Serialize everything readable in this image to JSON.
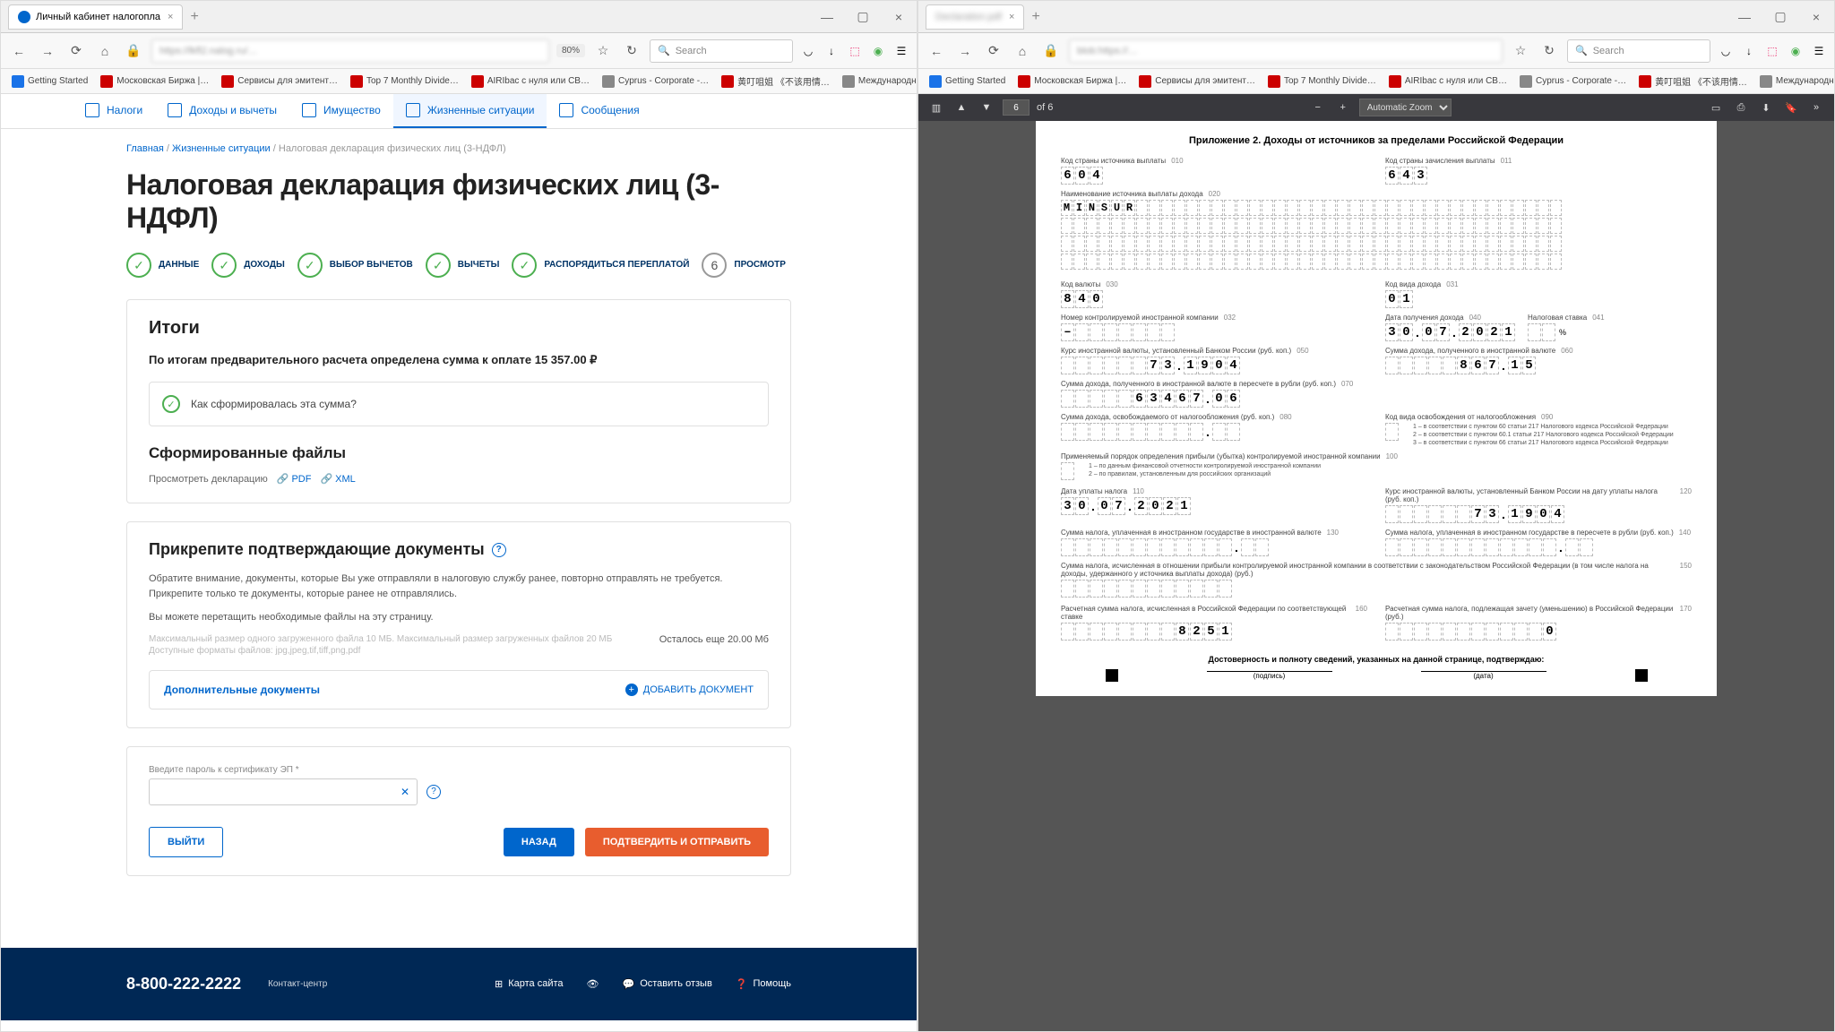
{
  "left": {
    "tab_title": "Личный кабинет налогопла",
    "zoom": "80%",
    "search_placeholder": "Search",
    "bookmarks": [
      "Getting Started",
      "Московская Биржа |…",
      "Сервисы для эмитент…",
      "Top 7 Monthly Divide…",
      "AIRIbac с нуля или СВ…",
      "Cyprus - Corporate -…",
      "黄叮咀姐 《不该用情…",
      "Международные ры…"
    ],
    "nav_items": [
      "Налоги",
      "Доходы и вычеты",
      "Имущество",
      "Жизненные ситуации",
      "Сообщения"
    ],
    "breadcrumb_home": "Главная",
    "breadcrumb_section": "Жизненные ситуации",
    "breadcrumb_current": "Налоговая декларация физических лиц (3-НДФЛ)",
    "page_title": "Налоговая декларация физических лиц (3-НДФЛ)",
    "steps": [
      "ДАННЫЕ",
      "ДОХОДЫ",
      "ВЫБОР ВЫЧЕТОВ",
      "ВЫЧЕТЫ",
      "РАСПОРЯДИТЬСЯ ПЕРЕПЛАТОЙ",
      "ПРОСМОТР"
    ],
    "results_heading": "Итоги",
    "results_text": "По итогам предварительного расчета определена сумма к оплате 15 357.00 ₽",
    "how_formed": "Как сформировалась эта сумма?",
    "files_heading": "Сформированные файлы",
    "view_declaration": "Просмотреть декларацию",
    "pdf_label": "PDF",
    "xml_label": "XML",
    "attach_heading": "Прикрепите подтверждающие документы",
    "attach_note1": "Обратите внимание, документы, которые Вы уже отправляли в налоговую службу ранее, повторно отправлять не требуется. Прикрепите только те документы, которые ранее не отправлялись.",
    "attach_note2": "Вы можете перетащить необходимые файлы на эту страницу.",
    "size_hint": "Максимальный размер одного загруженного файла 10 МБ. Максимальный размер загруженных файлов 20 МБ",
    "format_hint": "Доступные форматы файлов: jpg,jpeg,tif,tiff,png,pdf",
    "remaining": "Осталось еще 20.00 Мб",
    "extra_docs": "Дополнительные документы",
    "add_doc": "ДОБАВИТЬ ДОКУМЕНТ",
    "pwd_label": "Введите пароль к сертификату ЭП *",
    "btn_exit": "ВЫЙТИ",
    "btn_back": "НАЗАД",
    "btn_submit": "ПОДТВЕРДИТЬ И ОТПРАВИТЬ",
    "phone": "8-800-222-2222",
    "contact_center": "Контакт-центр",
    "footer_links": [
      "Карта сайта",
      "",
      "Оставить отзыв",
      "Помощь"
    ]
  },
  "right": {
    "page_current": "6",
    "page_total": "of 6",
    "zoom_mode": "Automatic Zoom",
    "doc_title": "Приложение 2. Доходы от источников за пределами Российской Федерации",
    "f010_label": "Код страны источника выплаты",
    "f010_code": "010",
    "f010_val": "604",
    "f011_label": "Код страны зачисления выплаты",
    "f011_code": "011",
    "f011_val": "643",
    "f020_label": "Наименование источника выплаты дохода",
    "f020_code": "020",
    "f020_val": "MINSUR",
    "f030_label": "Код валюты",
    "f030_code": "030",
    "f030_val": "840",
    "f031_label": "Код вида дохода",
    "f031_code": "031",
    "f031_val": "01",
    "f032_label": "Номер контролируемой иностранной компании",
    "f032_code": "032",
    "f032_val": "–",
    "f040_label": "Дата получения дохода",
    "f040_code": "040",
    "f040_val": "30.07.2021",
    "f041_label": "Налоговая ставка",
    "f041_code": "041",
    "f041_unit": "%",
    "f050_label": "Курс иностранной валюты, установленный Банком России (руб. коп.)",
    "f050_code": "050",
    "f050_val": "73.1904",
    "f060_label": "Сумма дохода, полученного в иностранной валюте",
    "f060_code": "060",
    "f060_val": "867.15",
    "f070_label": "Сумма дохода, полученного в иностранной валюте в пересчете в рубли (руб. коп.)",
    "f070_code": "070",
    "f070_val": "63467.06",
    "f080_label": "Сумма дохода, освобождаемого от налогообложения (руб. коп.)",
    "f080_code": "080",
    "f090_label": "Код вида освобождения от налогообложения",
    "f090_code": "090",
    "f090_legend1": "1 – в соответствии с пунктом 60 статьи 217 Налогового кодекса Российской Федерации",
    "f090_legend2": "2 – в соответствии с пунктом 60.1 статьи 217 Налогового кодекса Российской Федерации",
    "f090_legend3": "3 – в соответствии с пунктом 66 статьи 217 Налогового кодекса Российской Федерации",
    "f100_label": "Применяемый порядок определения прибыли (убытка) контролируемой иностранной компании",
    "f100_code": "100",
    "f100_legend1": "1 – по данным финансовой отчетности контролируемой иностранной компании",
    "f100_legend2": "2 – по правилам, установленным для российских организаций",
    "f110_label": "Дата уплаты налога",
    "f110_code": "110",
    "f110_val": "30.07.2021",
    "f120_label": "Курс иностранной валюты, установленный Банком России на дату уплаты налога (руб. коп.)",
    "f120_code": "120",
    "f120_val": "73.1904",
    "f130_label": "Сумма налога, уплаченная в иностранном государстве в иностранной валюте",
    "f130_code": "130",
    "f140_label": "Сумма налога, уплаченная в иностранном государстве в пересчете в рубли (руб. коп.)",
    "f140_code": "140",
    "f150_label": "Сумма налога, исчисленная в отношении прибыли контролируемой иностранной компании в соответствии с законодательством Российской Федерации (в том числе налога на доходы, удержанного у источника выплаты дохода) (руб.)",
    "f150_code": "150",
    "f160_label": "Расчетная сумма налога, исчисленная в Российской Федерации по соответствующей ставке",
    "f160_code": "160",
    "f160_val": "8251",
    "f170_label": "Расчетная сумма налога, подлежащая зачету (уменьшению) в Российской Федерации (руб.)",
    "f170_code": "170",
    "f170_val": "0",
    "confirm": "Достоверность и полноту сведений, указанных на данной странице, подтверждаю:",
    "sig1": "(подпись)",
    "sig2": "(дата)"
  }
}
